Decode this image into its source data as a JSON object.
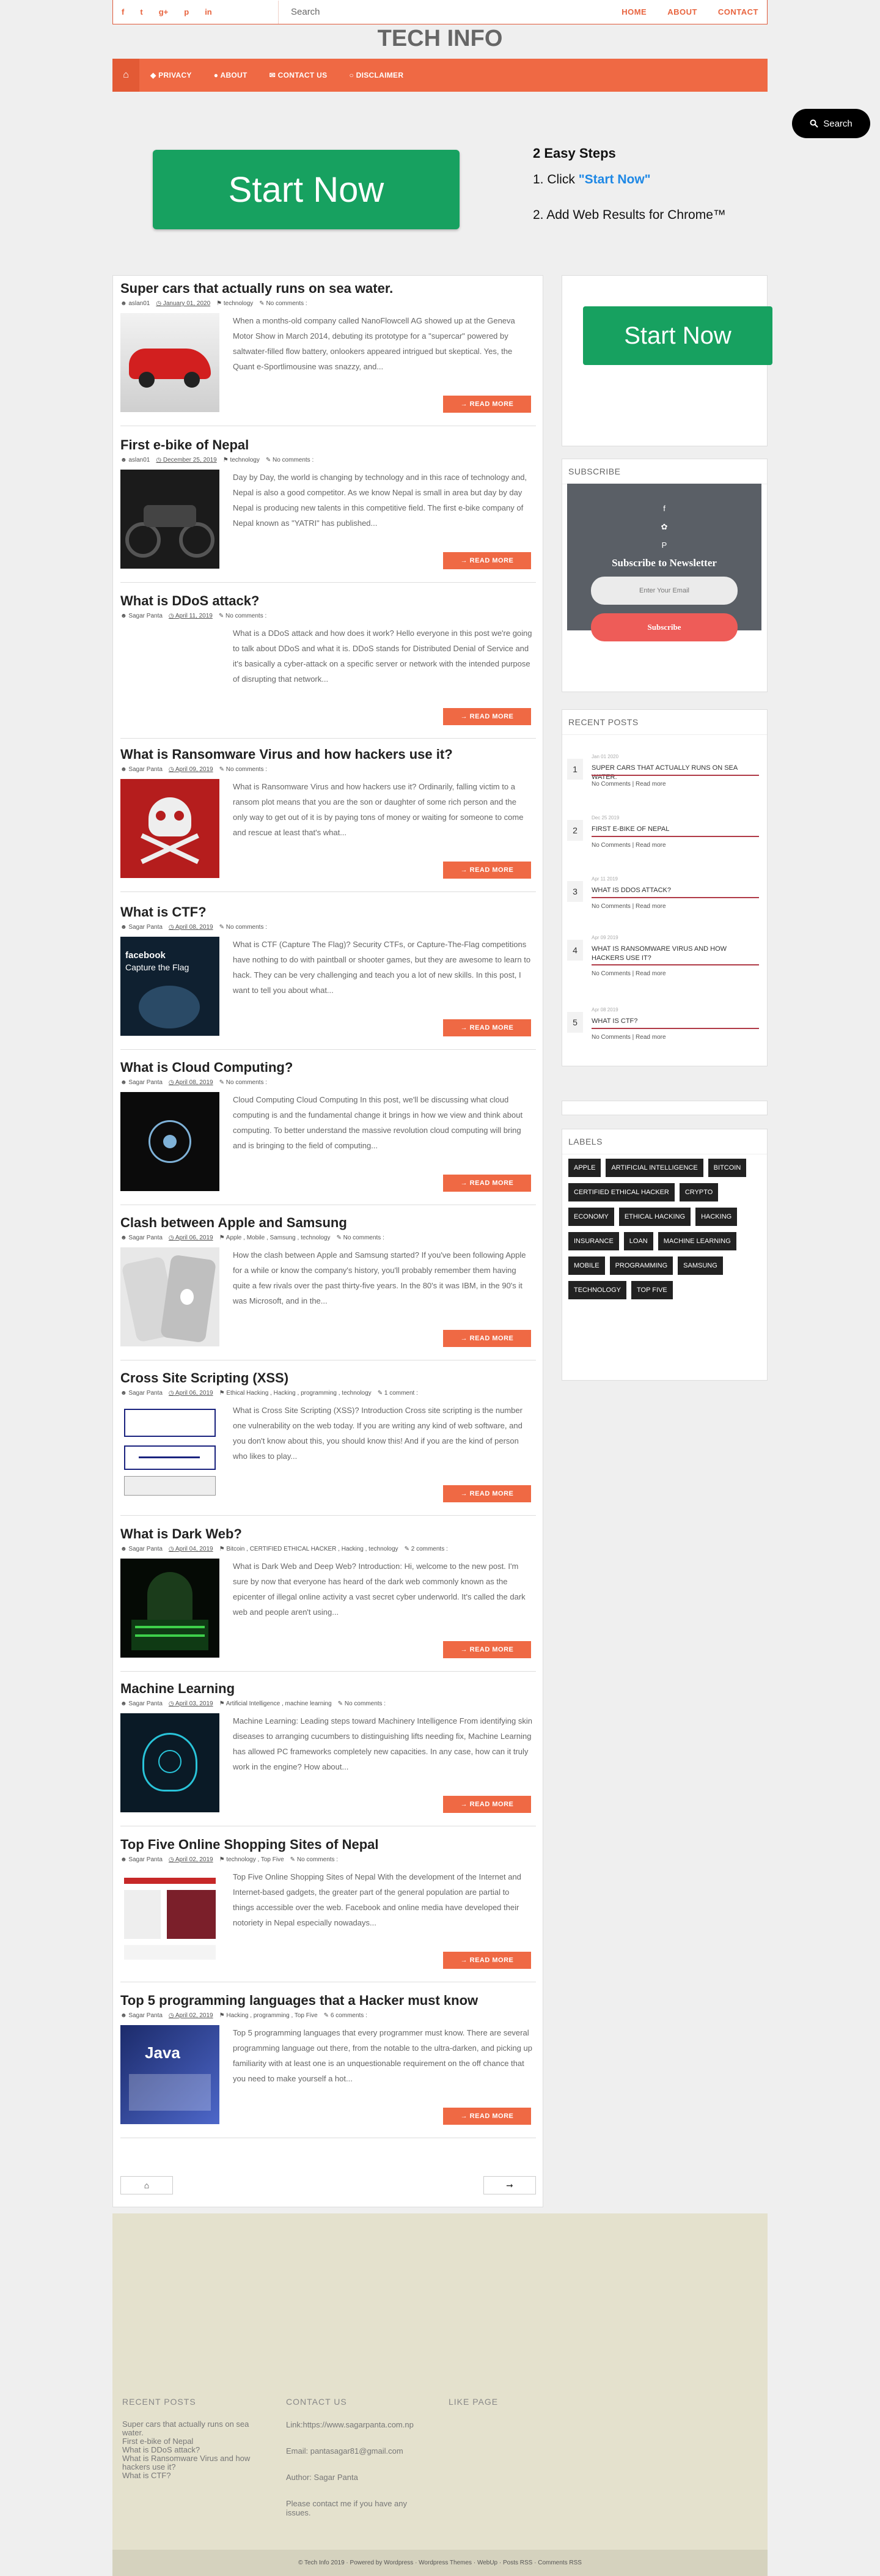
{
  "topbar": {
    "social": [
      "f",
      "t",
      "g+",
      "p",
      "in"
    ],
    "search_placeholder": "Search",
    "nav": [
      "HOME",
      "ABOUT",
      "CONTACT"
    ]
  },
  "site_title": "TECH INFO",
  "mainnav": {
    "home_icon": "home-icon",
    "items": [
      "PRIVACY",
      "ABOUT",
      "CONTACT US",
      "DISCLAIMER"
    ]
  },
  "floating_search": "Search",
  "promo": {
    "start_label": "Start Now",
    "steps_title": "2 Easy Steps",
    "step1_prefix": "1. Click ",
    "step1_link": "\"Start Now\"",
    "step2": "2. Add Web Results for Chrome™"
  },
  "read_more": "READ MORE",
  "posts": [
    {
      "title": "Super cars that actually runs on sea water.",
      "author": "aslan01",
      "date": "January 01, 2020",
      "tags": "technology",
      "comments": "No comments :",
      "excerpt": "When a months-old company called NanoFlowcell AG showed up at the Geneva Motor Show in March 2014, debuting its prototype for a \"supercar\" powered by saltwater-filled flow battery, onlookers appeared intrigued but skeptical. Yes, the Quant e-Sportlimousine was snazzy, and...",
      "thumb": "car"
    },
    {
      "title": "First e-bike of Nepal",
      "author": "aslan01",
      "date": "December 25, 2019",
      "tags": "technology",
      "comments": "No comments :",
      "excerpt": "Day by Day, the world is changing by technology and in this race of technology and, Nepal is also a good competitor. As we know Nepal is small in area but day by day Nepal is producing new talents in this competitive field. The first e-bike company of Nepal known as \"YATRI\" has published...",
      "thumb": "bike"
    },
    {
      "title": "What is DDoS attack?",
      "author": "Sagar Panta",
      "date": "April 11, 2019",
      "tags": "",
      "comments": "No comments :",
      "excerpt": "What is a DDoS attack and how does it work? Hello everyone in this post we're going to talk about DDoS and what it is. DDoS stands for Distributed Denial of Service and it's basically a cyber-attack on a specific server or network with the intended purpose of disrupting that network...",
      "thumb": "ddos"
    },
    {
      "title": "What is Ransomware Virus and how hackers use it?",
      "author": "Sagar Panta",
      "date": "April 09, 2019",
      "tags": "",
      "comments": "No comments :",
      "excerpt": "What is Ransomware Virus and how hackers use it? Ordinarily, falling victim to a ransom plot means that you are the son or daughter of some rich person and the only way to get out of it is by paying tons of money or waiting for someone to come and rescue at least that's what...",
      "thumb": "ransom"
    },
    {
      "title": "What is CTF?",
      "author": "Sagar Panta",
      "date": "April 08, 2019",
      "tags": "",
      "comments": "No comments :",
      "excerpt": "What is CTF (Capture The Flag)? Security CTFs, or Capture-The-Flag competitions have nothing to do with paintball or shooter games, but they are awesome to learn to hack. They can be very challenging and teach you a lot of new skills. In this post, I want to tell you about what...",
      "thumb": "ctf"
    },
    {
      "title": "What is Cloud Computing?",
      "author": "Sagar Panta",
      "date": "April 08, 2019",
      "tags": "",
      "comments": "No comments :",
      "excerpt": "Cloud Computing Cloud Computing In this post, we'll be discussing what cloud computing is and the fundamental change it brings in how we view and think about computing. To better understand the massive revolution cloud computing will bring and is bringing to the field of computing...",
      "thumb": "cloud"
    },
    {
      "title": "Clash between Apple and Samsung",
      "author": "Sagar Panta",
      "date": "April 06, 2019",
      "tags": "Apple , Mobile , Samsung , technology",
      "comments": "No comments :",
      "excerpt": "How the clash between Apple and Samsung started? If you've been following Apple for a while or know the company's history, you'll probably remember them having quite a few rivals over the past thirty-five years. In the 80's it was IBM, in the 90's it was Microsoft, and in the...",
      "thumb": "apple"
    },
    {
      "title": "Cross Site Scripting (XSS)",
      "author": "Sagar Panta",
      "date": "April 06, 2019",
      "tags": "Ethical Hacking , Hacking , programming , technology",
      "comments": "1 comment :",
      "excerpt": "What is Cross Site Scripting (XSS)? Introduction Cross site scripting is the number one vulnerability on the web today. If you are writing any kind of web software, and you don't know about this, you should know this! And if you are the kind of person who likes to play...",
      "thumb": "xss"
    },
    {
      "title": "What is Dark Web?",
      "author": "Sagar Panta",
      "date": "April 04, 2019",
      "tags": "Bitcoin , CERTIFIED ETHICAL HACKER , Hacking , technology",
      "comments": "2 comments :",
      "excerpt": "What is Dark Web and Deep Web? Introduction: Hi, welcome to the new post. I'm sure by now that everyone has heard of the dark web commonly known as the epicenter of illegal online activity a vast secret cyber underworld. It's called the dark web and people aren't using...",
      "thumb": "dark"
    },
    {
      "title": "Machine Learning",
      "author": "Sagar Panta",
      "date": "April 03, 2019",
      "tags": "Artificial Intelligence , machine learning",
      "comments": "No comments :",
      "excerpt": "Machine Learning: Leading steps toward Machinery Intelligence From identifying skin diseases to arranging cucumbers to distinguishing lifts needing fix, Machine Learning has allowed PC frameworks completely new capacities. In any case, how can it truly work in the engine? How about...",
      "thumb": "ml"
    },
    {
      "title": "Top Five Online Shopping Sites of Nepal",
      "author": "Sagar Panta",
      "date": "April 02, 2019",
      "tags": "technology , Top Five",
      "comments": "No comments :",
      "excerpt": "Top Five Online Shopping Sites of Nepal With the development of the Internet and Internet-based gadgets, the greater part of the general population are partial to things accessible over the web. Facebook and online media have developed their notoriety in Nepal especially nowadays...",
      "thumb": "shop"
    },
    {
      "title": "Top 5 programming languages that a Hacker must know",
      "author": "Sagar Panta",
      "date": "April 02, 2019",
      "tags": "Hacking , programming , Top Five",
      "comments": "6 comments :",
      "excerpt": "Top 5 programming languages that every programmer must know. There are several programming language out there, from the notable to the ultra-darken, and picking up familiarity with at least one is an unquestionable requirement on the off chance that you need to make yourself a hot...",
      "thumb": "java"
    }
  ],
  "pager": {
    "prev_icon": "home-icon",
    "next_icon": "arrow-right-icon"
  },
  "sidebar": {
    "start_label": "Start Now",
    "subscribe_title": "SUBSCRIBE",
    "newsletter_title": "Subscribe to Newsletter",
    "email_placeholder": "Enter Your Email",
    "subscribe_button": "Subscribe",
    "recent_title": "RECENT POSTS",
    "recent": [
      {
        "num": "1",
        "date": "Jan 01 2020",
        "title": "SUPER CARS THAT ACTUALLY RUNS ON SEA WATER.",
        "links": "No Comments | Read more"
      },
      {
        "num": "2",
        "date": "Dec 25 2019",
        "title": "FIRST E-BIKE OF NEPAL",
        "links": "No Comments | Read more"
      },
      {
        "num": "3",
        "date": "Apr 11 2019",
        "title": "WHAT IS DDOS ATTACK?",
        "links": "No Comments | Read more"
      },
      {
        "num": "4",
        "date": "Apr 09 2019",
        "title": "WHAT IS RANSOMWARE VIRUS AND HOW HACKERS USE IT?",
        "links": "No Comments | Read more"
      },
      {
        "num": "5",
        "date": "Apr 08 2019",
        "title": "WHAT IS CTF?",
        "links": "No Comments | Read more"
      }
    ],
    "labels_title": "LABELS",
    "labels": [
      "APPLE",
      "ARTIFICIAL INTELLIGENCE",
      "BITCOIN",
      "CERTIFIED ETHICAL HACKER",
      "CRYPTO",
      "ECONOMY",
      "ETHICAL HACKING",
      "HACKING",
      "INSURANCE",
      "LOAN",
      "MACHINE LEARNING",
      "MOBILE",
      "PROGRAMMING",
      "SAMSUNG",
      "TECHNOLOGY",
      "TOP FIVE"
    ]
  },
  "footer": {
    "recent_title": "RECENT POSTS",
    "recent_links": [
      "Super cars that actually runs on sea water.",
      "First e-bike of Nepal",
      "What is DDoS attack?",
      "What is Ransomware Virus and how hackers use it?",
      "What is CTF?"
    ],
    "contact_title": "CONTACT US",
    "contact_lines": [
      "Link:https://www.sagarpanta.com.np",
      "Email: pantasagar81@gmail.com",
      "Author: Sagar Panta",
      "Please contact me if you have any issues."
    ],
    "like_title": "LIKE PAGE",
    "bottom": "© Tech Info 2019 · Powered by Wordpress · Wordpress Themes · WebUp · Posts RSS · Comments RSS"
  }
}
